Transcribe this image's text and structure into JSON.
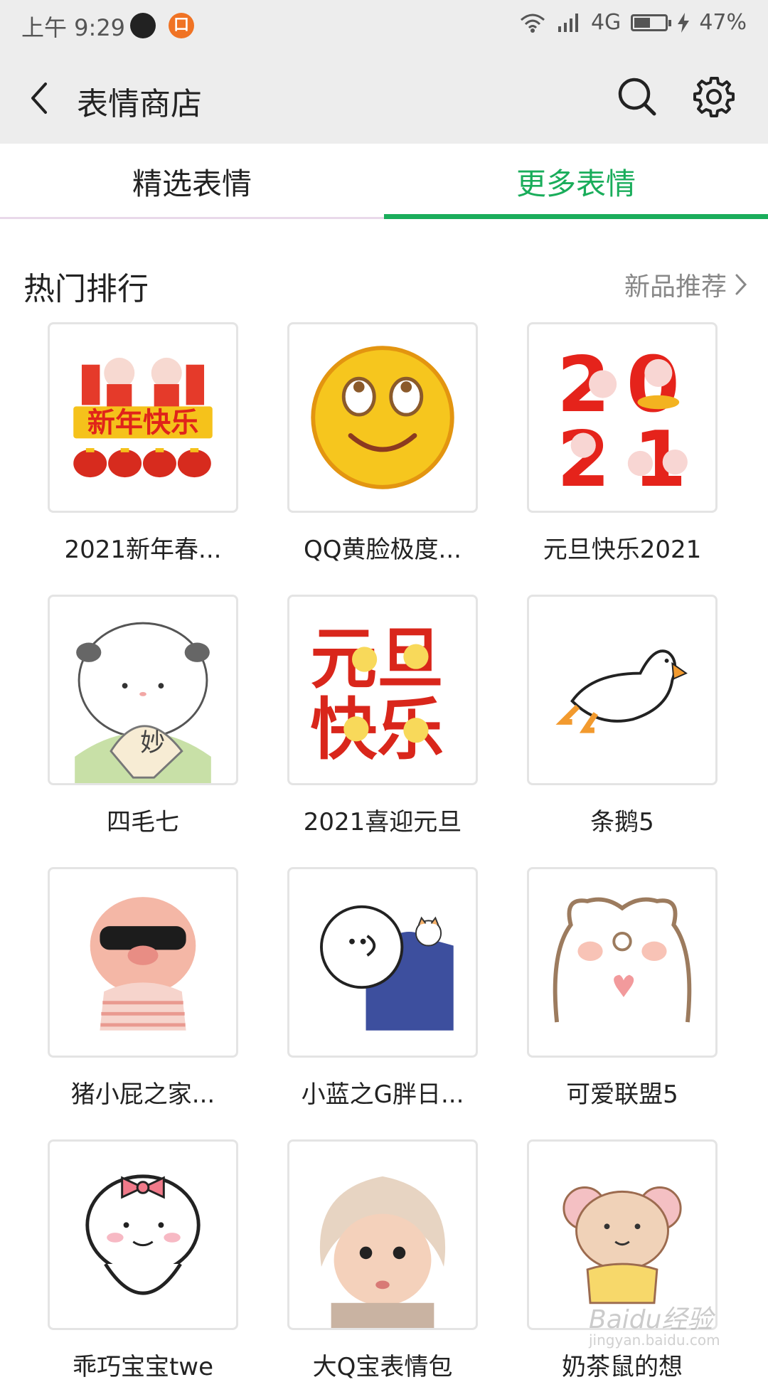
{
  "status_bar": {
    "time": "上午 9:29",
    "app_badge": "口",
    "network": "4G",
    "battery": "47%",
    "battery_level": 0.47
  },
  "header": {
    "title": "表情商店"
  },
  "tabs": [
    {
      "label": "精选表情",
      "selected": false
    },
    {
      "label": "更多表情",
      "selected": true
    }
  ],
  "section": {
    "title": "热门排行",
    "link_label": "新品推荐"
  },
  "stickers": [
    {
      "name": "2021新年春...",
      "icon": "new-year-ox-sticker"
    },
    {
      "name": "QQ黄脸极度...",
      "icon": "smiley-face-sticker"
    },
    {
      "name": "元旦快乐2021",
      "icon": "2021-pig-sticker"
    },
    {
      "name": "四毛七",
      "icon": "white-cat-fan-sticker"
    },
    {
      "name": "2021喜迎元旦",
      "icon": "yuandan-kuaile-sticker"
    },
    {
      "name": "条鹅5",
      "icon": "white-goose-sticker"
    },
    {
      "name": "猪小屁之家...",
      "icon": "cool-pig-sticker"
    },
    {
      "name": "小蓝之G胖日...",
      "icon": "blue-hoodie-sticker"
    },
    {
      "name": "可爱联盟5",
      "icon": "bear-heart-sticker"
    },
    {
      "name": "乖巧宝宝twe",
      "icon": "bow-baby-sticker"
    },
    {
      "name": "大Q宝表情包",
      "icon": "baby-dog-hat-sticker"
    },
    {
      "name": "奶茶鼠的想",
      "icon": "milk-tea-mouse-sticker"
    }
  ],
  "watermark": {
    "text": "Baidu经验",
    "sub": "jingyan.baidu.com"
  },
  "colors": {
    "accent": "#1aad5b",
    "header_bg": "#ededed"
  }
}
